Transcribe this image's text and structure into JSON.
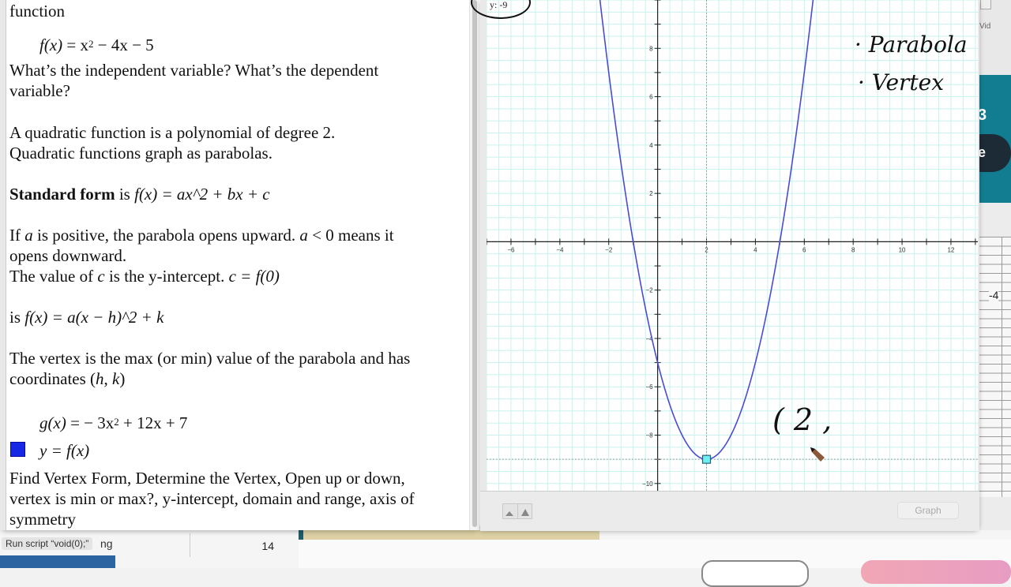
{
  "document": {
    "lines": {
      "l1": "function",
      "f_def_lhs": "f(x)",
      "f_def_eq": " = x",
      "f_def_exp": "2",
      "f_def_rest": " − 4x − 5",
      "q_vars": "What’s the independent variable?  What’s the dependent",
      "q_vars2": "variable?",
      "quad1": "A quadratic function is a polynomial of degree 2.",
      "quad2": "Quadratic functions graph as parabolas.",
      "std_bold": "Standard form",
      "std_is": " is ",
      "std_formula": "f(x) = ax^2  +  bx  +  c",
      "a_pos1_a": "If ",
      "a_pos1_var": "a",
      "a_pos1_b": "  is positive, the parabola opens upward.  ",
      "a_pos1_c": "a",
      "a_pos1_d": " < 0 means it",
      "a_pos2": "opens downward.",
      "c_val_a": "The value of ",
      "c_val_var": "c",
      "c_val_b": " is the y-intercept.  ",
      "c_val_formula": "c = f(0)",
      "vertex_form_is": " is ",
      "vertex_form_formula": "f(x) = a(x − h)^2  +  k",
      "vertex1": "The vertex is the max (or min) value of the parabola and has",
      "vertex2_a": "coordinates (",
      "vertex2_h": "h",
      "vertex2_comma": ", ",
      "vertex2_k": "k",
      "vertex2_b": ")",
      "g_lhs": "g(x)",
      "g_eq": " = − 3x",
      "g_exp": "2",
      "g_rest": " + 12x + 7",
      "y_f": "y = f(x)",
      "task1": "Find Vertex Form, Determine the Vertex, Open up or down,",
      "task2": "vertex is min or max?, y-intercept, domain and range, axis of",
      "task3": "symmetry"
    },
    "legend_color": "#1627e6"
  },
  "status_tooltip": "Run script “void(0);”",
  "background": {
    "partial_text": "ng",
    "cell_value": "14",
    "right_label": "Vid",
    "sheet_value": "-4",
    "teal_glyph": "3",
    "pill_text": "e"
  },
  "grapher": {
    "coord_readout": "y: -9",
    "graph_button": "Graph"
  },
  "annotations": {
    "bullet1": "· Parabola",
    "bullet2": "· Vertex",
    "vertex_partial": "( 2 ,"
  },
  "chart_data": {
    "type": "line",
    "title": "",
    "function": "f(x) = x^2 - 4x - 5",
    "series": [
      {
        "name": "y = f(x)",
        "color": "#4b4bd6",
        "x": [
          -1,
          0,
          1,
          2,
          3,
          4,
          5
        ],
        "y": [
          0,
          -5,
          -8,
          -9,
          -8,
          -5,
          0
        ]
      }
    ],
    "highlighted_point": {
      "x": 2,
      "y": -9,
      "label": "vertex"
    },
    "xlim": [
      -7.0,
      13.1
    ],
    "ylim": [
      -10.3,
      10
    ],
    "x_ticks": [
      -6,
      -4,
      -2,
      2,
      4,
      6,
      8,
      10,
      12
    ],
    "y_ticks": [
      -10,
      -8,
      -6,
      -4,
      -2,
      2,
      4,
      6,
      8
    ],
    "grid": true,
    "grid_color": "#c8f3ee",
    "xlabel": "",
    "ylabel": ""
  }
}
